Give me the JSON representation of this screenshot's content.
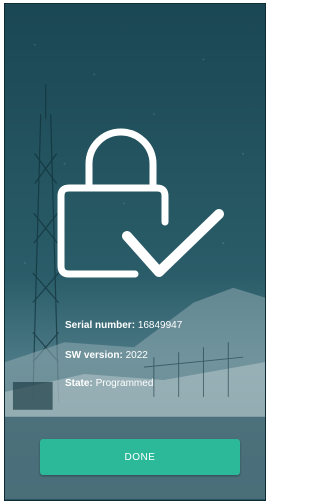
{
  "device": {
    "serial_label": "Serial number:",
    "serial_value": "16849947",
    "sw_label": "SW version:",
    "sw_value": "2022",
    "state_label": "State:",
    "state_value": "Programmed"
  },
  "actions": {
    "done_label": "DONE"
  },
  "icons": {
    "status": "lock-check-icon"
  },
  "colors": {
    "background": "#1c4a56",
    "accent": "#2bb99a",
    "text": "#ffffff"
  }
}
